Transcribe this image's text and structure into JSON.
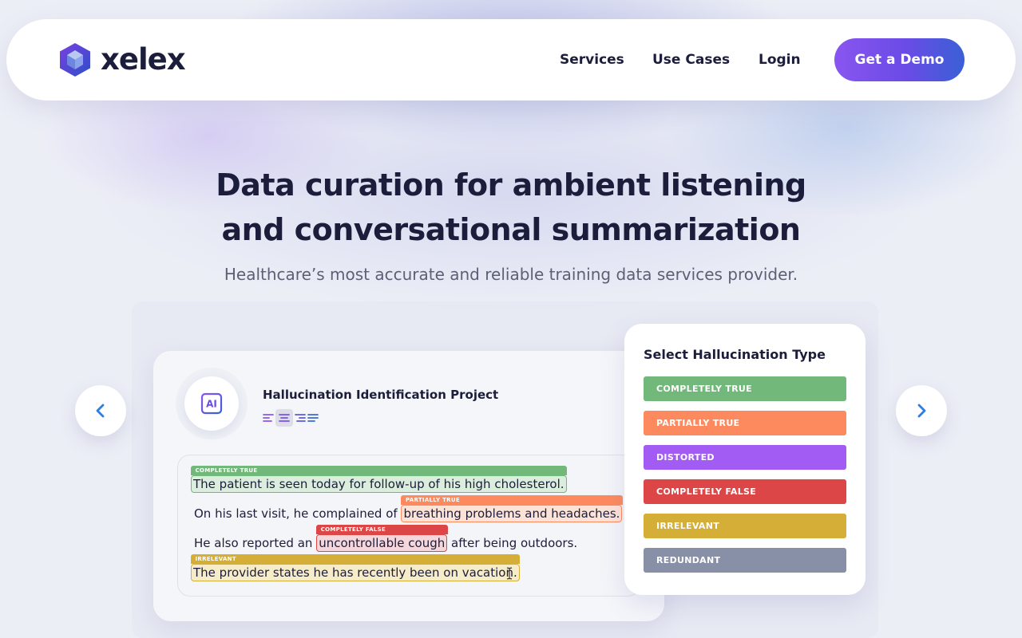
{
  "brand": {
    "name": "xelex"
  },
  "nav": {
    "links": [
      {
        "label": "Services"
      },
      {
        "label": "Use Cases"
      },
      {
        "label": "Login"
      }
    ],
    "cta_label": "Get a Demo"
  },
  "hero": {
    "title_line1": "Data curation for ambient listening",
    "title_line2": "and conversational summarization",
    "subtitle": "Healthcare’s most accurate and reliable training data services provider."
  },
  "card": {
    "ai_label": "AI",
    "project_title": "Hallucination Identification Project",
    "transcript": {
      "line1": {
        "tag": "COMPLETELY TRUE",
        "text": "The patient is seen today for follow-up of his high cholesterol."
      },
      "line2": {
        "before": "On his last visit, he complained of",
        "tag": "PARTIALLY TRUE",
        "highlight": "breathing problems and headaches."
      },
      "line3": {
        "before": "He also reported an",
        "tag": "COMPLETELY FALSE",
        "highlight": "uncontrollable cough",
        "after": "after being outdoors."
      },
      "line4": {
        "tag": "IRRELEVANT",
        "text": "The provider states he has recently been on vacation."
      }
    }
  },
  "panel": {
    "title": "Select Hallucination Type",
    "types": [
      {
        "label": "COMPLETELY TRUE",
        "color": "#72b87a"
      },
      {
        "label": "PARTIALLY TRUE",
        "color": "#fd8a5e"
      },
      {
        "label": "DISTORTED",
        "color": "#a35cf3"
      },
      {
        "label": "COMPLETELY FALSE",
        "color": "#dc4646"
      },
      {
        "label": "IRRELEVANT",
        "color": "#d4ae37"
      },
      {
        "label": "REDUNDANT",
        "color": "#8890a8"
      }
    ]
  },
  "colors": {
    "accent_purple": "#8a55f0",
    "accent_blue": "#3a60d6",
    "arrow_blue": "#2f7de1",
    "text_dark": "#1b1d3a"
  },
  "icons": {
    "prev": "chevron-left-icon",
    "next": "chevron-right-icon",
    "logo": "hexagon-logo-icon",
    "ai": "ai-chip-icon",
    "cursor": "text-cursor-icon"
  }
}
